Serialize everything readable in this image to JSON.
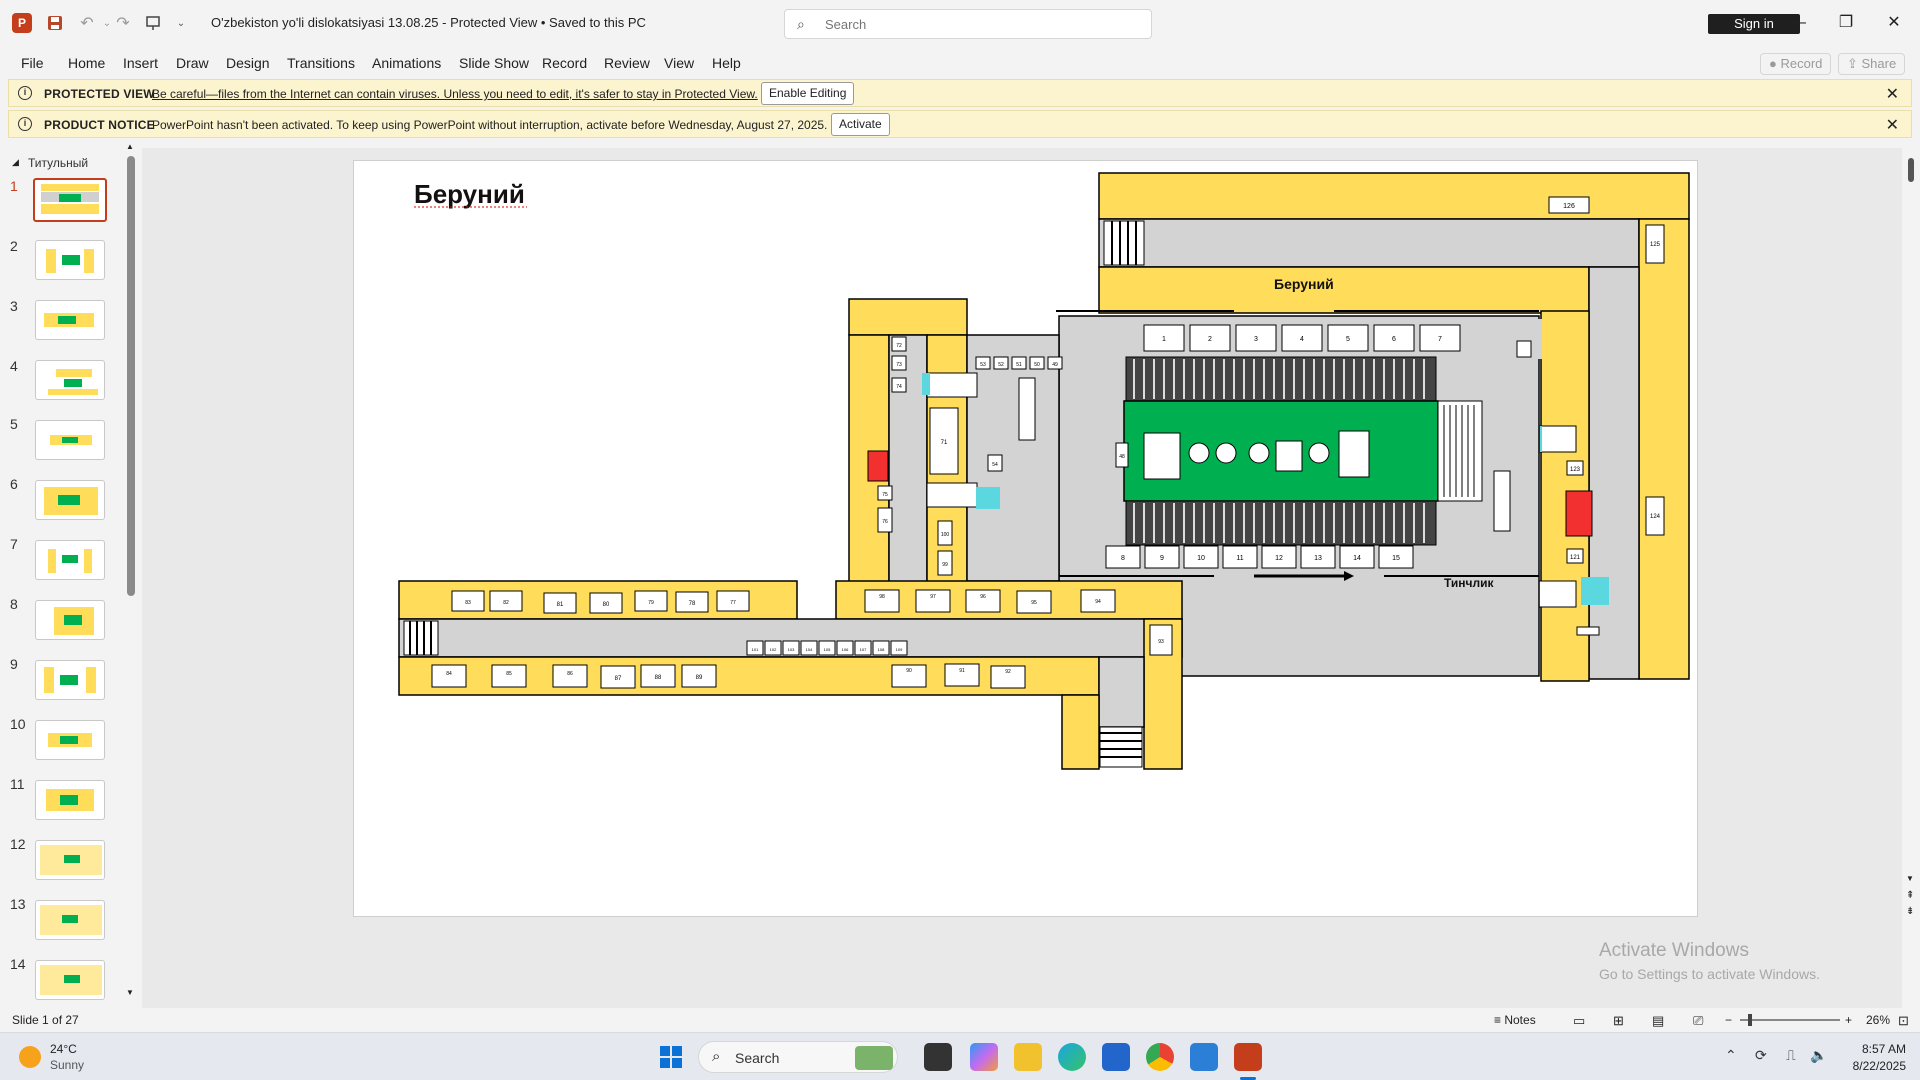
{
  "window": {
    "title": "O'zbekiston yo'li dislokatsiyasi 13.08.25  -  Protected View • Saved to this PC",
    "search_placeholder": "Search",
    "signin_label": "Sign in"
  },
  "ribbon": {
    "tabs": [
      "File",
      "Home",
      "Insert",
      "Draw",
      "Design",
      "Transitions",
      "Animations",
      "Slide Show",
      "Record",
      "Review",
      "View",
      "Help"
    ],
    "record_label": "Record",
    "share_label": "Share"
  },
  "banners": {
    "protected": {
      "title": "PROTECTED VIEW",
      "message": "Be careful—files from the Internet can contain viruses. Unless you need to edit, it's safer to stay in Protected View.",
      "button": "Enable Editing"
    },
    "notice": {
      "title": "PRODUCT NOTICE",
      "message": "PowerPoint hasn't been activated. To keep using PowerPoint without interruption, activate before Wednesday, August 27, 2025.",
      "button": "Activate"
    }
  },
  "thumbnails": {
    "section_title": "Титульный",
    "numbers": [
      "1",
      "2",
      "3",
      "4",
      "5",
      "6",
      "7",
      "8",
      "9",
      "10",
      "11",
      "12",
      "13",
      "14"
    ]
  },
  "slide": {
    "title": "Беруний",
    "station_label": "Беруний",
    "exit_label": "Тинчлик",
    "booths_top": [
      "1",
      "2",
      "3",
      "4",
      "5",
      "6",
      "7"
    ],
    "booths_bottom": [
      "8",
      "9",
      "10",
      "11",
      "12",
      "13",
      "14",
      "15"
    ],
    "left_top_row": [
      "83",
      "82",
      "81",
      "80",
      "79",
      "78",
      "77"
    ],
    "left_bottom_row": [
      "84",
      "85",
      "86",
      "87",
      "88",
      "89"
    ],
    "mid_top_row": [
      "98",
      "97",
      "96",
      "95",
      "94"
    ],
    "mid_bottom_row": [
      "90",
      "91",
      "92"
    ],
    "small_row": [
      "101",
      "102",
      "103",
      "104",
      "105",
      "106",
      "107",
      "108",
      "109"
    ],
    "small_top": [
      "53",
      "52",
      "51",
      "50",
      "49"
    ],
    "right_labels": [
      "126",
      "125",
      "124",
      "123",
      "121"
    ],
    "left_column": [
      "72",
      "73",
      "74",
      "75",
      "76"
    ],
    "misc": [
      "93",
      "99",
      "100",
      "54",
      "48",
      "71"
    ]
  },
  "statusbar": {
    "slide_info": "Slide 1 of 27",
    "notes_label": "Notes",
    "zoom": "26%"
  },
  "watermark": {
    "line1": "Activate Windows",
    "line2": "Go to Settings to activate Windows."
  },
  "taskbar": {
    "temperature": "24°C",
    "weather": "Sunny",
    "search_label": "Search",
    "time": "8:57 AM",
    "date": "8/22/2025"
  }
}
